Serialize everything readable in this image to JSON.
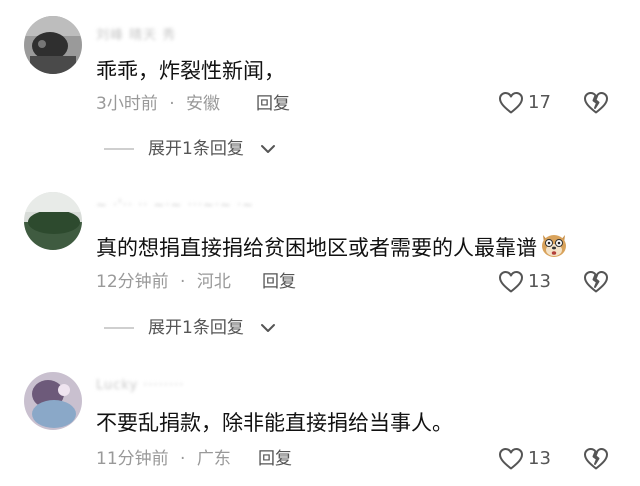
{
  "comments": [
    {
      "username": "刘峰 晴天 秀",
      "text": "乖乖，炸裂性新闻，",
      "time": "3小时前",
      "location": "安徽",
      "reply_label": "回复",
      "likes": "17",
      "expand_label": "展开1条回复"
    },
    {
      "username": "~ ·'·· ·· ~·~ ···~·~ ·~",
      "text": "真的想捐直接捐给贫困地区或者需要的人最靠谱",
      "time": "12分钟前",
      "location": "河北",
      "reply_label": "回复",
      "likes": "13",
      "expand_label": "展开1条回复"
    },
    {
      "username": "Lucky  ········",
      "text": "不要乱捐款，除非能直接捐给当事人。",
      "time": "11分钟前",
      "location": "广东",
      "reply_label": "回复",
      "likes": "13"
    }
  ],
  "meta_separator": "·",
  "icons": {
    "like": "heart-outline-icon",
    "dislike": "broken-heart-icon",
    "expand": "chevron-down-icon",
    "emoji": "dog-face-emoji"
  }
}
